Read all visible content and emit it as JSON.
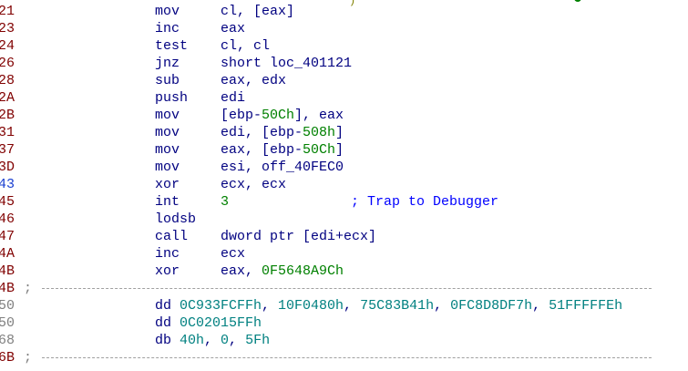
{
  "listing": [
    {
      "addr": "21",
      "mn": "mov",
      "ops": [
        {
          "t": "cl, [eax]"
        }
      ]
    },
    {
      "addr": "23",
      "mn": "inc",
      "ops": [
        {
          "t": "eax"
        }
      ]
    },
    {
      "addr": "24",
      "mn": "test",
      "ops": [
        {
          "t": "cl, cl"
        }
      ]
    },
    {
      "addr": "26",
      "mn": "jnz",
      "ops": [
        {
          "t": "short loc_401121"
        }
      ]
    },
    {
      "addr": "28",
      "mn": "sub",
      "ops": [
        {
          "t": "eax, edx"
        }
      ]
    },
    {
      "addr": "2A",
      "mn": "push",
      "ops": [
        {
          "t": "edi"
        }
      ]
    },
    {
      "addr": "2B",
      "mn": "mov",
      "ops": [
        {
          "t": "[ebp-"
        },
        {
          "t": "50Ch",
          "c": "num"
        },
        {
          "t": "], eax"
        }
      ]
    },
    {
      "addr": "31",
      "mn": "mov",
      "ops": [
        {
          "t": "edi, [ebp-"
        },
        {
          "t": "508h",
          "c": "num"
        },
        {
          "t": "]"
        }
      ]
    },
    {
      "addr": "37",
      "mn": "mov",
      "ops": [
        {
          "t": "eax, [ebp-"
        },
        {
          "t": "50Ch",
          "c": "num"
        },
        {
          "t": "]"
        }
      ]
    },
    {
      "addr": "3D",
      "mn": "mov",
      "ops": [
        {
          "t": "esi, off_40FEC0"
        }
      ]
    },
    {
      "addr": "43",
      "addrClass": "blue",
      "mn": "xor",
      "ops": [
        {
          "t": "ecx, ecx"
        }
      ]
    },
    {
      "addr": "45",
      "mn": "int",
      "ops": [
        {
          "t": "3",
          "c": "num"
        }
      ],
      "comment": "; Trap to Debugger"
    },
    {
      "addr": "46",
      "mn": "lodsb",
      "ops": []
    },
    {
      "addr": "47",
      "mn": "call",
      "ops": [
        {
          "t": "dword ptr [edi+ecx]"
        }
      ]
    },
    {
      "addr": "4A",
      "mn": "inc",
      "ops": [
        {
          "t": "ecx"
        }
      ]
    },
    {
      "addr": "4B",
      "mn": "xor",
      "ops": [
        {
          "t": "eax, "
        },
        {
          "t": "0F5648A9Ch",
          "c": "num"
        }
      ]
    },
    {
      "addr": "4B",
      "sep": ";"
    },
    {
      "addr": "50",
      "addrClass": "gray",
      "data": true,
      "mn": "dd",
      "ops": [
        {
          "t": "0C933FCFFh",
          "c": "data"
        },
        {
          "t": ", "
        },
        {
          "t": "10F0480h",
          "c": "data"
        },
        {
          "t": ", "
        },
        {
          "t": "75C83B41h",
          "c": "data"
        },
        {
          "t": ", "
        },
        {
          "t": "0FC8D8DF7h",
          "c": "data"
        },
        {
          "t": ", "
        },
        {
          "t": "51FFFFFEh",
          "c": "data"
        }
      ]
    },
    {
      "addr": "50",
      "addrClass": "gray",
      "data": true,
      "mn": "dd",
      "ops": [
        {
          "t": "0C02015FFh",
          "c": "data"
        }
      ]
    },
    {
      "addr": "68",
      "addrClass": "gray",
      "data": true,
      "mn": "db",
      "ops": [
        {
          "t": "40h",
          "c": "data"
        },
        {
          "t": ", "
        },
        {
          "t": "0",
          "c": "data"
        },
        {
          "t": ", "
        },
        {
          "t": "5Fh",
          "c": "data"
        }
      ]
    },
    {
      "addr": "6B",
      "sep": ";"
    }
  ]
}
